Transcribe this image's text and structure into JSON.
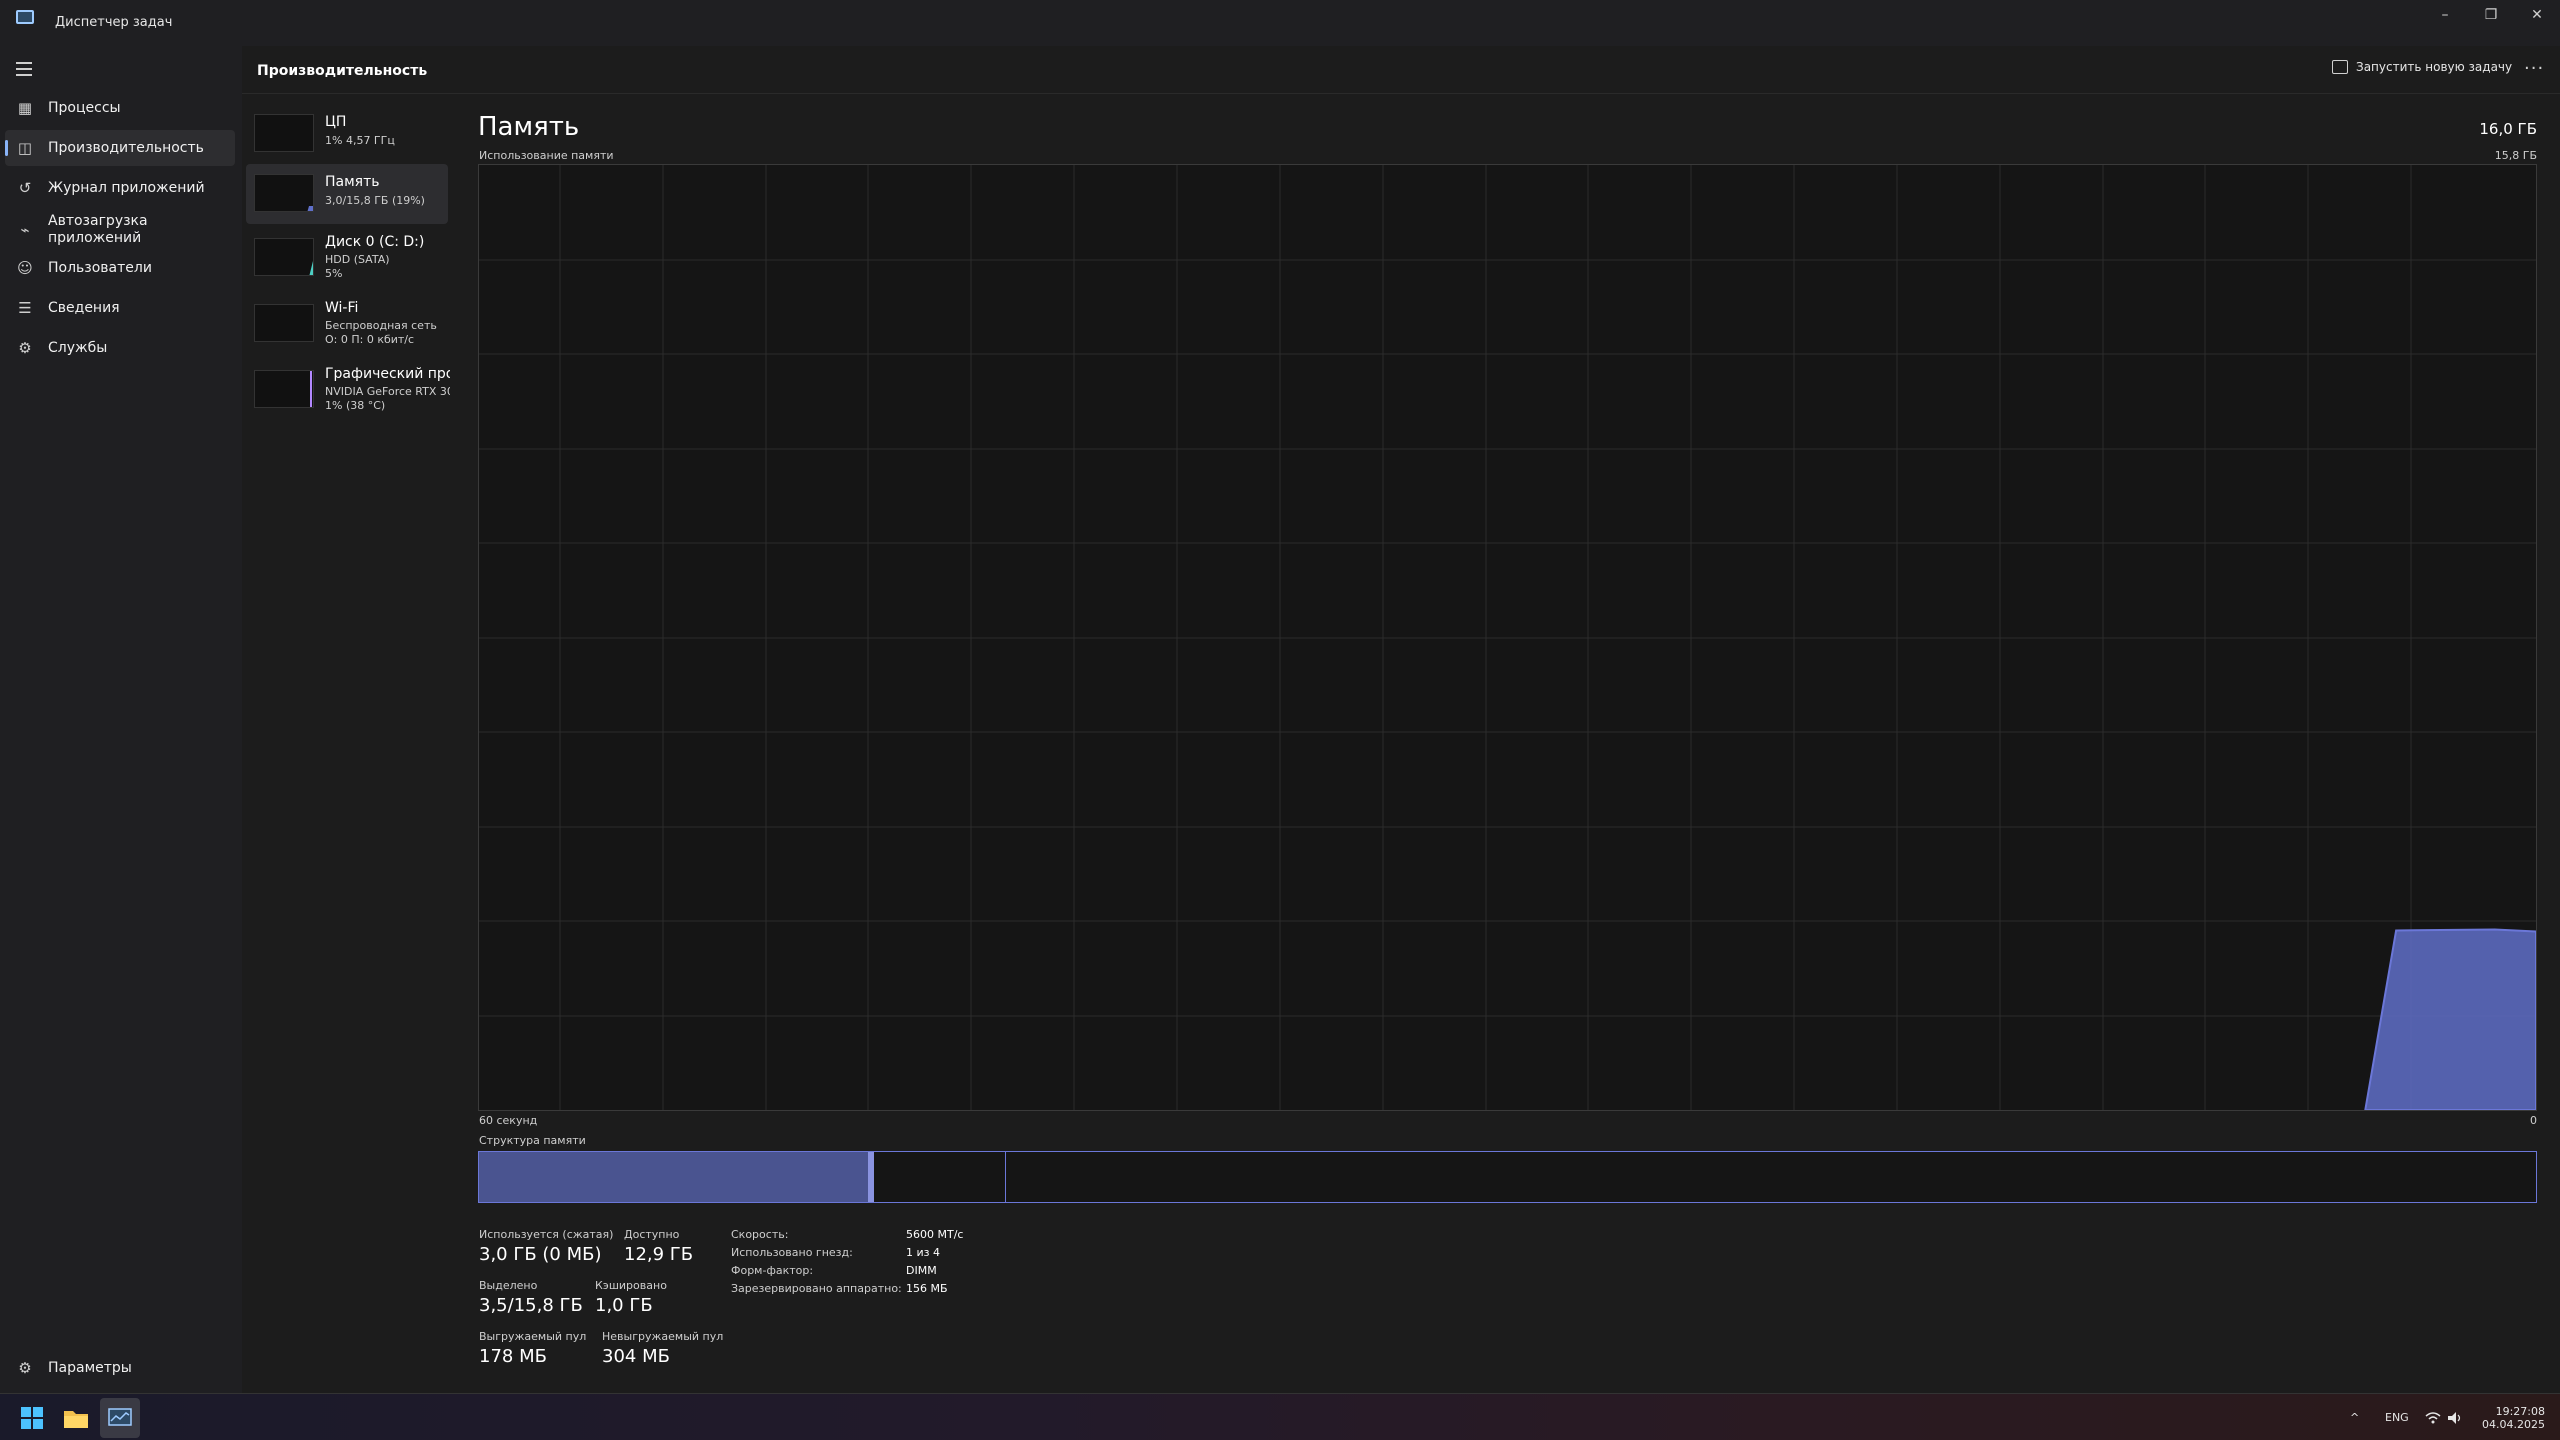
{
  "window": {
    "title": "Диспетчер задач",
    "minimize": "–",
    "restore": "❐",
    "close": "✕"
  },
  "sidebar": {
    "items": [
      {
        "label": "Процессы",
        "icon": "processes-icon"
      },
      {
        "label": "Производительность",
        "icon": "performance-icon"
      },
      {
        "label": "Журнал приложений",
        "icon": "history-icon"
      },
      {
        "label": "Автозагрузка приложений",
        "icon": "startup-icon"
      },
      {
        "label": "Пользователи",
        "icon": "users-icon"
      },
      {
        "label": "Сведения",
        "icon": "details-icon"
      },
      {
        "label": "Службы",
        "icon": "services-icon"
      }
    ],
    "settings": "Параметры"
  },
  "header": {
    "title": "Производительность",
    "run_new_task": "Запустить новую задачу",
    "more": "···"
  },
  "perf_list": [
    {
      "name": "ЦП",
      "line1": "1% 4,57 ГГц",
      "line2": "",
      "color": "#4fc3f7"
    },
    {
      "name": "Память",
      "line1": "3,0/15,8 ГБ (19%)",
      "line2": "",
      "color": "#6b77d8"
    },
    {
      "name": "Диск 0 (C: D:)",
      "line1": "HDD (SATA)",
      "line2": "5%",
      "color": "#4dd0c4"
    },
    {
      "name": "Wi-Fi",
      "line1": "Беспроводная сеть",
      "line2": "О: 0 П: 0 кбит/с",
      "color": "#e07ca0"
    },
    {
      "name": "Графический про",
      "line1": "NVIDIA GeForce RTX 307",
      "line2": "1% (38 °C)",
      "color": "#b388ff"
    }
  ],
  "memory": {
    "title": "Память",
    "total": "16,0 ГБ",
    "usage_label": "Использование памяти",
    "usage_max": "15,8 ГБ",
    "graph_left": "60 секунд",
    "graph_right": "0",
    "structure_label": "Структура памяти",
    "in_use_fraction": 0.19,
    "structure": {
      "in_use": 0.189,
      "modified": 0.003,
      "standby": 0.064
    },
    "stats": {
      "in_use_label": "Используется (сжатая)",
      "in_use_value": "3,0 ГБ (0 МБ)",
      "available_label": "Доступно",
      "available_value": "12,9 ГБ",
      "committed_label": "Выделено",
      "committed_value": "3,5/15,8 ГБ",
      "cached_label": "Кэшировано",
      "cached_value": "1,0 ГБ",
      "paged_label": "Выгружаемый пул",
      "paged_value": "178 МБ",
      "nonpaged_label": "Невыгружаемый пул",
      "nonpaged_value": "304 МБ"
    },
    "details": [
      {
        "label": "Скорость:",
        "value": "5600 МТ/с"
      },
      {
        "label": "Использовано гнезд:",
        "value": "1 из 4"
      },
      {
        "label": "Форм-фактор:",
        "value": "DIMM"
      },
      {
        "label": "Зарезервировано аппаратно:",
        "value": "156 МБ"
      }
    ]
  },
  "colors": {
    "accent": "#6b77d8",
    "fill": "#5f6fc8",
    "grid": "#2c2c2c"
  },
  "taskbar": {
    "lang": "ENG",
    "time": "19:27:08",
    "date": "04.04.2025",
    "chevron": "^"
  }
}
